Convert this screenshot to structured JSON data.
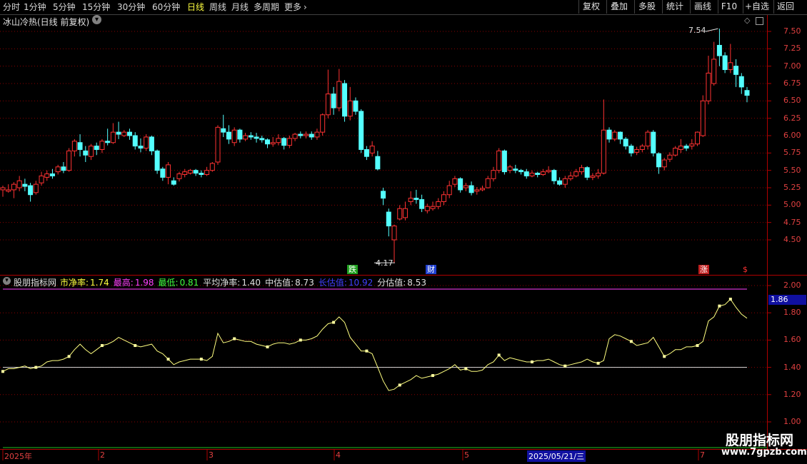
{
  "toolbar": {
    "periods": [
      {
        "label": "分时",
        "active": false
      },
      {
        "label": "1分钟",
        "active": false
      },
      {
        "label": "5分钟",
        "active": false
      },
      {
        "label": "15分钟",
        "active": false
      },
      {
        "label": "30分钟",
        "active": false
      },
      {
        "label": "60分钟",
        "active": false
      },
      {
        "label": "日线",
        "active": true
      },
      {
        "label": "周线",
        "active": false
      },
      {
        "label": "月线",
        "active": false
      },
      {
        "label": "多周期",
        "active": false
      },
      {
        "label": "更多",
        "active": false
      }
    ],
    "more_arrow": "›",
    "right_buttons": [
      "复权",
      "叠加",
      "多股",
      "统计",
      "画线",
      "F10",
      "+自选",
      "返回"
    ]
  },
  "main_chart": {
    "title": "冰山冷热(日线 前复权)",
    "price_ticks": [
      "7.50",
      "7.25",
      "7.00",
      "6.75",
      "6.50",
      "6.25",
      "6.00",
      "5.75",
      "5.50",
      "5.25",
      "5.00",
      "4.75",
      "4.50"
    ],
    "high_label": "7.54",
    "low_label": "4.17",
    "badges": [
      {
        "text": "跌",
        "color": "#20a020"
      },
      {
        "text": "财",
        "color": "#2040d0"
      },
      {
        "text": "涨",
        "color": "#c02020"
      },
      {
        "text": "$",
        "color": "#c02020"
      }
    ]
  },
  "indicator": {
    "name": "股朋指标网",
    "items": [
      {
        "label": "市净率:",
        "value": "1.74",
        "color": "#ffff40"
      },
      {
        "label": "最高:",
        "value": "1.98",
        "color": "#ff40ff"
      },
      {
        "label": "最低:",
        "value": "0.81",
        "color": "#40ff40"
      },
      {
        "label": "平均净率:",
        "value": "1.40",
        "color": "#e0e0e0"
      },
      {
        "label": "中估值:",
        "value": "8.73",
        "color": "#e0e0e0"
      },
      {
        "label": "长估值:",
        "value": "10.92",
        "color": "#4040ff"
      },
      {
        "label": "分估值:",
        "value": "8.53",
        "color": "#e0e0e0"
      }
    ],
    "current_value": "1.86",
    "ticks": [
      "2.00",
      "1.80",
      "1.60",
      "1.40",
      "1.20",
      "1.00"
    ]
  },
  "timeline": {
    "labels": [
      "2025年",
      "2",
      "3",
      "4",
      "5",
      "2025/05/21/三",
      "7"
    ]
  },
  "watermark": {
    "line1": "股朋指标网",
    "line2": "www.7gpzb.com"
  },
  "colors": {
    "up": "#ff3232",
    "down": "#54ffff",
    "indicator_line": "#ffff80",
    "marker": "#ffffa0",
    "grid": "#8b0000"
  },
  "chart_data": {
    "type": "candlestick",
    "ylim": [
      4.2,
      7.65
    ],
    "candles": [
      [
        5.22,
        5.25,
        5.12,
        5.28
      ],
      [
        5.2,
        5.22,
        5.18,
        5.3
      ],
      [
        5.22,
        5.3,
        5.1,
        5.33
      ],
      [
        5.25,
        5.35,
        5.2,
        5.42
      ],
      [
        5.3,
        5.27,
        5.2,
        5.38
      ],
      [
        5.28,
        5.15,
        5.05,
        5.32
      ],
      [
        5.18,
        5.3,
        5.15,
        5.35
      ],
      [
        5.32,
        5.42,
        5.28,
        5.48
      ],
      [
        5.4,
        5.45,
        5.35,
        5.5
      ],
      [
        5.45,
        5.42,
        5.38,
        5.52
      ],
      [
        5.48,
        5.55,
        5.44,
        5.58
      ],
      [
        5.55,
        5.5,
        5.46,
        5.62
      ],
      [
        5.5,
        5.78,
        5.48,
        5.82
      ],
      [
        5.78,
        5.92,
        5.7,
        5.95
      ],
      [
        5.9,
        5.8,
        5.7,
        6.02
      ],
      [
        5.78,
        5.72,
        5.62,
        5.85
      ],
      [
        5.7,
        5.85,
        5.65,
        5.88
      ],
      [
        5.85,
        5.8,
        5.72,
        5.9
      ],
      [
        5.8,
        5.92,
        5.75,
        5.95
      ],
      [
        5.92,
        5.9,
        5.86,
        6.1
      ],
      [
        5.9,
        6.05,
        5.88,
        6.18
      ],
      [
        6.05,
        6.02,
        5.95,
        6.2
      ],
      [
        6.0,
        6.05,
        5.98,
        6.08
      ],
      [
        6.05,
        6.0,
        5.94,
        6.1
      ],
      [
        6.0,
        5.85,
        5.8,
        6.05
      ],
      [
        5.85,
        5.82,
        5.76,
        5.96
      ],
      [
        5.82,
        5.98,
        5.78,
        6.02
      ],
      [
        5.98,
        5.78,
        5.72,
        6.0
      ],
      [
        5.78,
        5.5,
        5.45,
        5.8
      ],
      [
        5.52,
        5.4,
        5.35,
        5.55
      ],
      [
        5.4,
        5.58,
        5.3,
        5.62
      ],
      [
        5.35,
        5.3,
        5.28,
        5.4
      ],
      [
        5.38,
        5.45,
        5.34,
        5.48
      ],
      [
        5.44,
        5.48,
        5.4,
        5.52
      ],
      [
        5.46,
        5.5,
        5.44,
        5.52
      ],
      [
        5.5,
        5.46,
        5.42,
        5.52
      ],
      [
        5.46,
        5.44,
        5.4,
        5.5
      ],
      [
        5.44,
        5.5,
        5.42,
        5.55
      ],
      [
        5.5,
        5.6,
        5.48,
        5.62
      ],
      [
        5.62,
        6.12,
        5.58,
        6.15
      ],
      [
        6.1,
        6.05,
        5.98,
        6.3
      ],
      [
        6.05,
        5.95,
        5.88,
        6.15
      ],
      [
        5.9,
        6.08,
        5.85,
        6.12
      ],
      [
        6.08,
        5.95,
        5.9,
        6.1
      ],
      [
        5.95,
        6.0,
        5.92,
        6.04
      ],
      [
        6.0,
        5.98,
        5.94,
        6.05
      ],
      [
        5.98,
        5.96,
        5.9,
        6.04
      ],
      [
        5.96,
        5.94,
        5.9,
        6.0
      ],
      [
        5.94,
        5.88,
        5.82,
        5.96
      ],
      [
        5.88,
        5.9,
        5.84,
        5.98
      ],
      [
        5.9,
        5.96,
        5.86,
        6.02
      ],
      [
        5.96,
        5.86,
        5.8,
        5.98
      ],
      [
        5.86,
        5.96,
        5.82,
        6.0
      ],
      [
        5.96,
        6.02,
        5.92,
        6.04
      ],
      [
        6.02,
        6.0,
        5.96,
        6.06
      ],
      [
        6.0,
        6.02,
        5.96,
        6.06
      ],
      [
        6.02,
        5.98,
        5.94,
        6.06
      ],
      [
        5.98,
        6.05,
        5.94,
        6.1
      ],
      [
        6.05,
        6.3,
        6.0,
        6.32
      ],
      [
        6.3,
        6.6,
        6.25,
        6.95
      ],
      [
        6.6,
        6.4,
        6.3,
        6.7
      ],
      [
        6.4,
        6.78,
        6.35,
        6.96
      ],
      [
        6.75,
        6.28,
        6.2,
        6.8
      ],
      [
        6.28,
        6.5,
        6.22,
        6.7
      ],
      [
        6.5,
        6.35,
        6.3,
        6.55
      ],
      [
        6.35,
        5.8,
        5.75,
        6.38
      ],
      [
        5.8,
        5.7,
        5.65,
        5.85
      ],
      [
        5.75,
        5.85,
        5.7,
        5.92
      ],
      [
        5.7,
        5.52,
        5.5,
        5.78
      ],
      [
        5.2,
        5.1,
        5.0,
        5.25
      ],
      [
        4.9,
        4.7,
        4.55,
        4.95
      ],
      [
        4.5,
        4.7,
        4.17,
        4.72
      ],
      [
        4.8,
        4.95,
        4.78,
        5.0
      ],
      [
        4.82,
        4.95,
        4.78,
        5.05
      ],
      [
        5.05,
        5.1,
        5.0,
        5.2
      ],
      [
        5.1,
        5.08,
        5.02,
        5.22
      ],
      [
        5.08,
        4.95,
        4.9,
        5.15
      ],
      [
        4.92,
        4.98,
        4.88,
        5.02
      ],
      [
        4.95,
        4.98,
        4.92,
        5.05
      ],
      [
        4.98,
        5.05,
        4.94,
        5.1
      ],
      [
        5.05,
        5.15,
        5.0,
        5.2
      ],
      [
        5.15,
        5.28,
        5.1,
        5.35
      ],
      [
        5.3,
        5.38,
        5.26,
        5.42
      ],
      [
        5.38,
        5.22,
        5.18,
        5.4
      ],
      [
        5.25,
        5.28,
        5.2,
        5.32
      ],
      [
        5.28,
        5.18,
        5.14,
        5.34
      ],
      [
        5.2,
        5.22,
        5.15,
        5.26
      ],
      [
        5.22,
        5.24,
        5.2,
        5.28
      ],
      [
        5.25,
        5.38,
        5.24,
        5.42
      ],
      [
        5.38,
        5.5,
        5.34,
        5.55
      ],
      [
        5.5,
        5.78,
        5.46,
        5.82
      ],
      [
        5.78,
        5.48,
        5.44,
        5.8
      ],
      [
        5.5,
        5.55,
        5.46,
        5.58
      ],
      [
        5.52,
        5.5,
        5.46,
        5.58
      ],
      [
        5.5,
        5.48,
        5.44,
        5.52
      ],
      [
        5.48,
        5.42,
        5.38,
        5.52
      ],
      [
        5.42,
        5.46,
        5.4,
        5.5
      ],
      [
        5.46,
        5.44,
        5.4,
        5.48
      ],
      [
        5.44,
        5.48,
        5.42,
        5.52
      ],
      [
        5.48,
        5.5,
        5.46,
        5.56
      ],
      [
        5.5,
        5.35,
        5.3,
        5.52
      ],
      [
        5.35,
        5.3,
        5.28,
        5.4
      ],
      [
        5.3,
        5.38,
        5.25,
        5.42
      ],
      [
        5.38,
        5.42,
        5.35,
        5.48
      ],
      [
        5.42,
        5.48,
        5.4,
        5.52
      ],
      [
        5.48,
        5.54,
        5.44,
        5.58
      ],
      [
        5.54,
        5.4,
        5.36,
        5.56
      ],
      [
        5.4,
        5.42,
        5.36,
        5.46
      ],
      [
        5.42,
        5.46,
        5.38,
        5.52
      ],
      [
        5.46,
        6.08,
        5.44,
        6.52
      ],
      [
        6.08,
        5.95,
        5.9,
        6.12
      ],
      [
        5.95,
        6.05,
        5.92,
        6.08
      ],
      [
        6.05,
        5.95,
        5.88,
        6.06
      ],
      [
        5.95,
        5.85,
        5.8,
        5.98
      ],
      [
        5.85,
        5.75,
        5.7,
        5.88
      ],
      [
        5.76,
        5.8,
        5.72,
        5.84
      ],
      [
        5.8,
        5.85,
        5.76,
        5.88
      ],
      [
        5.85,
        6.05,
        5.8,
        6.08
      ],
      [
        6.05,
        5.75,
        5.7,
        6.08
      ],
      [
        5.74,
        5.55,
        5.45,
        5.76
      ],
      [
        5.55,
        5.65,
        5.5,
        5.68
      ],
      [
        5.66,
        5.72,
        5.62,
        5.76
      ],
      [
        5.72,
        5.82,
        5.7,
        5.85
      ],
      [
        5.8,
        5.85,
        5.75,
        5.95
      ],
      [
        5.85,
        5.82,
        5.78,
        5.88
      ],
      [
        5.85,
        5.88,
        5.8,
        5.95
      ],
      [
        5.88,
        6.05,
        5.85,
        6.06
      ],
      [
        6.0,
        6.5,
        5.98,
        6.58
      ],
      [
        6.5,
        6.9,
        6.45,
        7.15
      ],
      [
        6.75,
        7.1,
        6.72,
        7.35
      ],
      [
        7.3,
        7.15,
        7.0,
        7.54
      ],
      [
        7.15,
        6.95,
        6.9,
        7.2
      ],
      [
        6.95,
        7.05,
        6.9,
        7.32
      ],
      [
        7.0,
        6.88,
        6.7,
        7.1
      ],
      [
        6.85,
        6.7,
        6.6,
        6.9
      ],
      [
        6.65,
        6.58,
        6.48,
        6.7
      ]
    ],
    "indicator_series": [
      1.37,
      1.39,
      1.39,
      1.4,
      1.41,
      1.39,
      1.4,
      1.41,
      1.44,
      1.45,
      1.45,
      1.46,
      1.48,
      1.53,
      1.57,
      1.53,
      1.5,
      1.53,
      1.56,
      1.57,
      1.59,
      1.62,
      1.6,
      1.58,
      1.56,
      1.55,
      1.56,
      1.57,
      1.52,
      1.5,
      1.46,
      1.42,
      1.44,
      1.45,
      1.46,
      1.46,
      1.46,
      1.45,
      1.48,
      1.65,
      1.58,
      1.59,
      1.61,
      1.6,
      1.59,
      1.59,
      1.57,
      1.56,
      1.55,
      1.57,
      1.58,
      1.58,
      1.57,
      1.58,
      1.6,
      1.6,
      1.61,
      1.63,
      1.68,
      1.72,
      1.73,
      1.77,
      1.73,
      1.62,
      1.57,
      1.52,
      1.52,
      1.5,
      1.4,
      1.3,
      1.23,
      1.24,
      1.27,
      1.29,
      1.31,
      1.34,
      1.32,
      1.33,
      1.34,
      1.35,
      1.37,
      1.39,
      1.42,
      1.38,
      1.39,
      1.37,
      1.37,
      1.38,
      1.42,
      1.44,
      1.49,
      1.45,
      1.47,
      1.46,
      1.45,
      1.44,
      1.44,
      1.45,
      1.45,
      1.46,
      1.44,
      1.42,
      1.41,
      1.42,
      1.43,
      1.44,
      1.46,
      1.44,
      1.43,
      1.45,
      1.61,
      1.64,
      1.63,
      1.61,
      1.59,
      1.56,
      1.57,
      1.58,
      1.62,
      1.55,
      1.48,
      1.5,
      1.53,
      1.53,
      1.55,
      1.55,
      1.56,
      1.59,
      1.74,
      1.77,
      1.85,
      1.86,
      1.9,
      1.84,
      1.79,
      1.76
    ]
  }
}
